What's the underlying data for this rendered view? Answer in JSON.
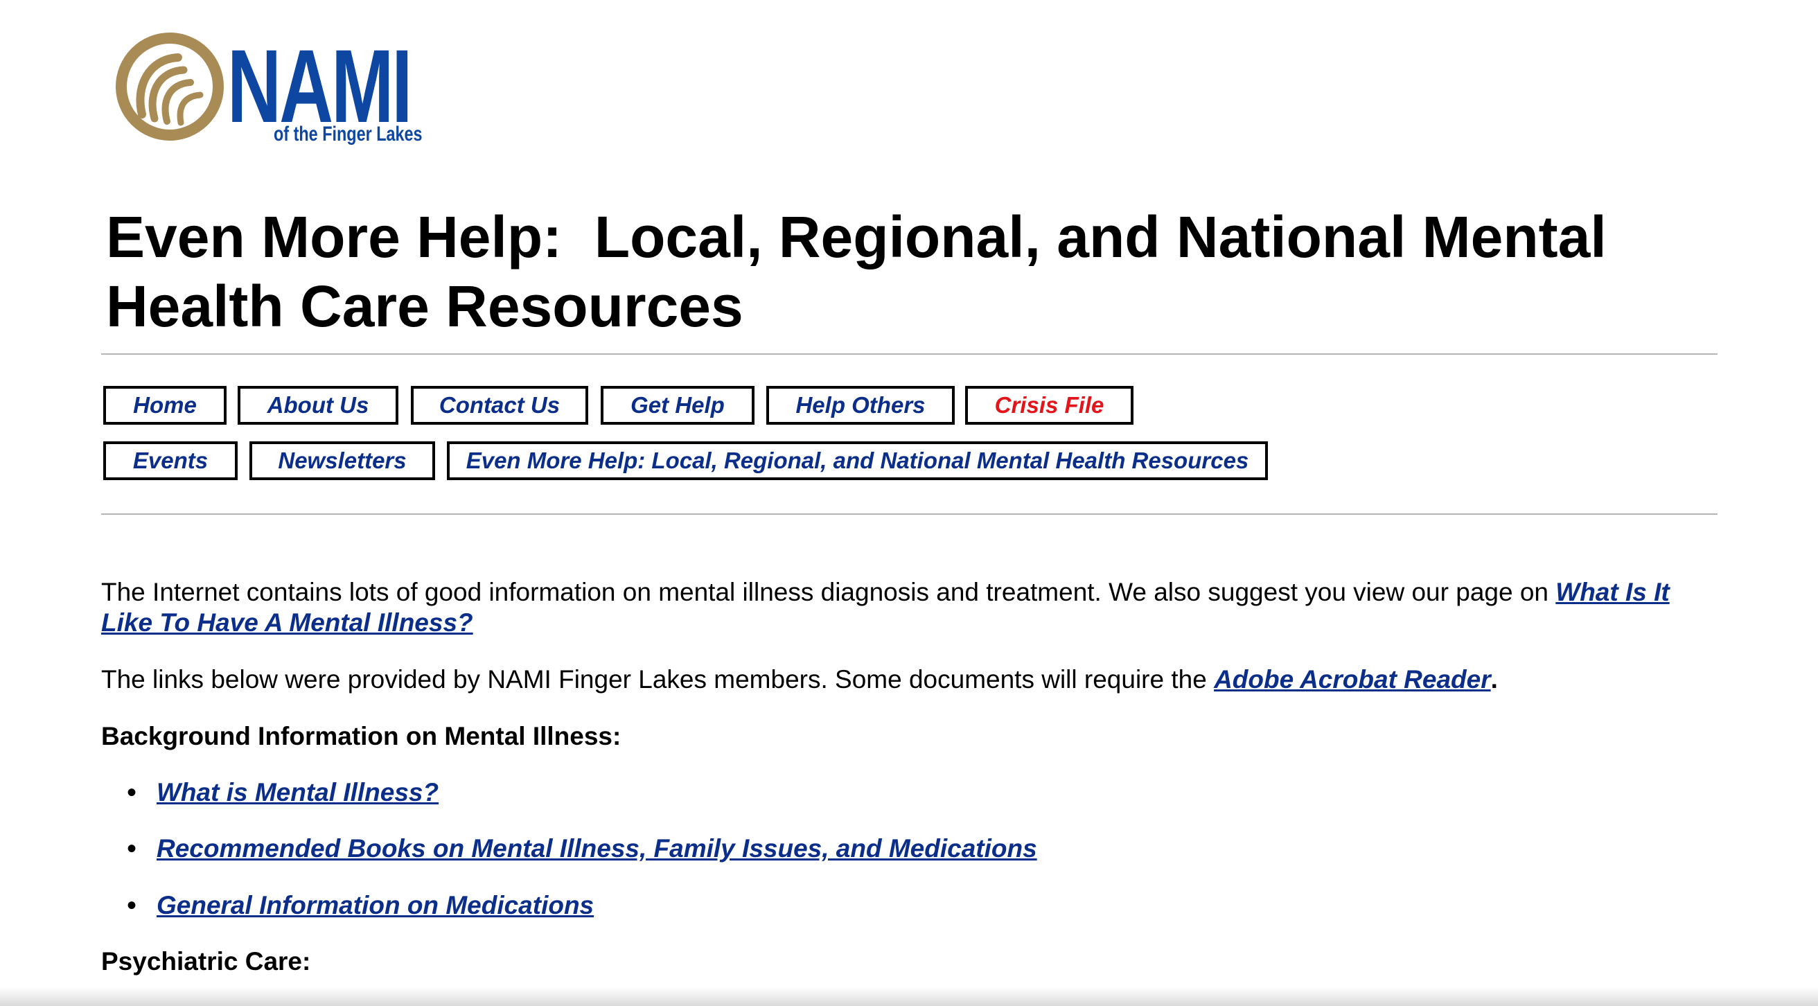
{
  "logo": {
    "word": "NAMI",
    "subtitle": "of the Finger Lakes",
    "colors": {
      "gold": "#a88b55",
      "blue": "#0d47a1"
    }
  },
  "page_title": "Even More Help:  Local, Regional, and National Mental Health Care Resources",
  "nav": {
    "home": "Home",
    "about": "About Us",
    "contact": "Contact Us",
    "get_help": "Get Help",
    "help_others": "Help Others",
    "crisis_file": "Crisis File",
    "events": "Events",
    "newsletters": "Newsletters",
    "even_more_help": "Even More Help: Local, Regional, and National Mental Health Resources"
  },
  "intro": {
    "text": "The Internet contains lots of good information on mental illness diagnosis and treatment.  We also suggest you view our page on ",
    "link": "What Is It Like To Have A Mental Illness?"
  },
  "links_note": {
    "text": "The links below were provided by NAMI Finger Lakes members.  Some documents will require the ",
    "link": "Adobe Acrobat Reader",
    "suffix": "."
  },
  "sections": {
    "background": {
      "heading": "Background Information on Mental Illness:",
      "items": [
        "What is Mental Illness?",
        "Recommended Books on Mental Illness, Family Issues, and Medications",
        "General Information on Medications"
      ]
    },
    "psychiatric": {
      "heading": "Psychiatric Care:"
    }
  },
  "colors": {
    "link": "#0b2e8a",
    "crisis": "#e4141b",
    "rule": "#b5b5b5"
  }
}
